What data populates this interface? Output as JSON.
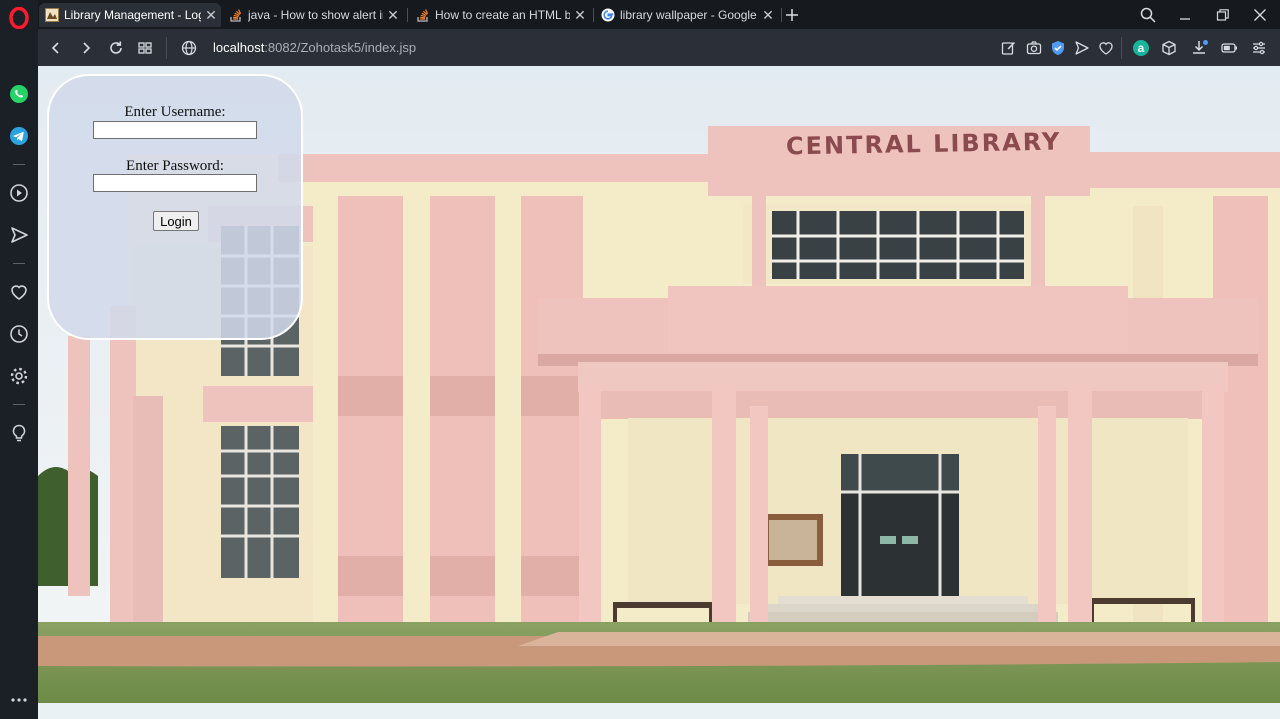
{
  "browser": {
    "tabs": [
      {
        "title": "Library Management - Login",
        "favicon": "library-favicon",
        "active": true
      },
      {
        "title": "java - How to show alert in",
        "favicon": "stackoverflow-icon",
        "active": false
      },
      {
        "title": "How to create an HTML bu",
        "favicon": "stackoverflow-icon",
        "active": false
      },
      {
        "title": "library wallpaper - Google",
        "favicon": "google-icon",
        "active": false
      }
    ],
    "url_host": "localhost",
    "url_rest": ":8082/Zohotask5/index.jsp"
  },
  "sidebar": {
    "items": [
      "opera-logo",
      "whatsapp-icon",
      "telegram-icon",
      "player-icon",
      "send-icon",
      "heart-icon",
      "history-icon",
      "settings-icon",
      "lightbulb-icon",
      "more-icon"
    ]
  },
  "building": {
    "sign_text": "CENTRAL LIBRARY"
  },
  "login": {
    "username_label": "Enter Username:",
    "password_label": "Enter Password:",
    "username_value": "",
    "password_value": "",
    "button_label": "Login"
  },
  "colors": {
    "building_pink": "#eec2bd",
    "building_cream": "#f5ecc9",
    "sky": "#e6eef4",
    "grass": "#7d9a55",
    "path": "#c9987b"
  }
}
